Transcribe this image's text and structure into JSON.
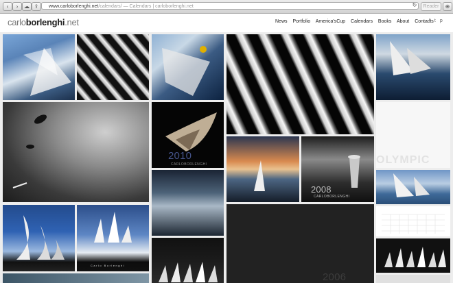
{
  "browser": {
    "url_host": "www.carloborlenghi.net",
    "url_path": "/calendars/",
    "url_rest": " — Calendars | carloborlenghi.net",
    "reader_label": "Reader"
  },
  "site": {
    "logo_first": "carlo",
    "logo_last": "borlenghi",
    "logo_tld": ".net",
    "nav": [
      "News",
      "Portfolio",
      "America'sCup",
      "Calendars",
      "Books",
      "About",
      "Contacts"
    ],
    "social": [
      "f",
      "t",
      "p"
    ]
  },
  "tiles": {
    "year_2010": "2010",
    "brand_2010": "CARLOBORLENGHI",
    "year_2008": "2008",
    "brand_2008": "CARLOBORLENGHI",
    "olympic": "OLYMPIC",
    "year_2006": "2006",
    "signature": "Carlo Borlenghi"
  }
}
